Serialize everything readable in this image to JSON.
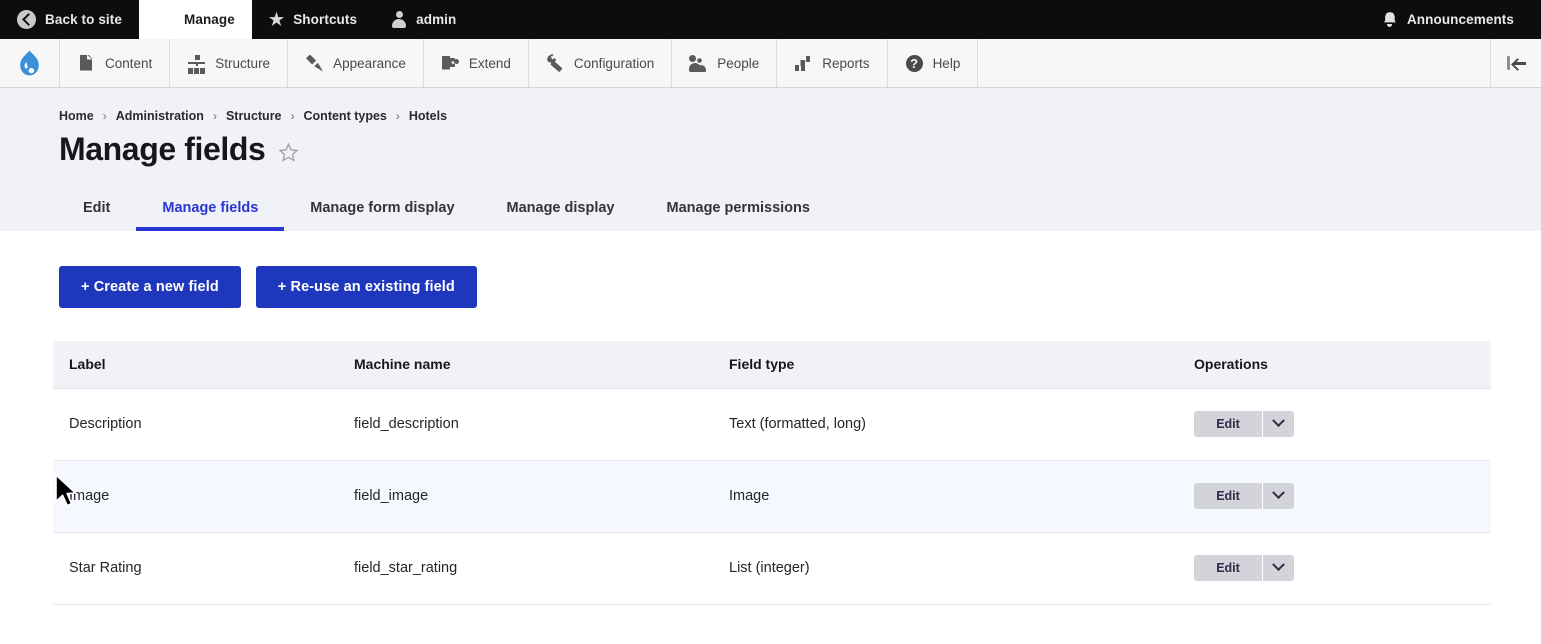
{
  "toolbar": {
    "back_to_site": "Back to site",
    "manage": "Manage",
    "shortcuts": "Shortcuts",
    "user": "admin",
    "announcements": "Announcements",
    "icons": {
      "back": "back-circle-icon",
      "manage": "hamburger-icon",
      "shortcuts": "star-icon",
      "user": "person-icon",
      "announcements": "bell-icon"
    }
  },
  "admin_menu": {
    "logo": "drupal-droplet-logo",
    "items": [
      {
        "label": "Content",
        "icon": "document-icon"
      },
      {
        "label": "Structure",
        "icon": "sitemap-icon"
      },
      {
        "label": "Appearance",
        "icon": "paintbrush-icon"
      },
      {
        "label": "Extend",
        "icon": "puzzle-piece-icon"
      },
      {
        "label": "Configuration",
        "icon": "wrench-icon"
      },
      {
        "label": "People",
        "icon": "people-icon"
      },
      {
        "label": "Reports",
        "icon": "bar-chart-icon"
      },
      {
        "label": "Help",
        "icon": "question-circle-icon"
      }
    ],
    "orientation_toggle": "collapse-sidebar-icon"
  },
  "breadcrumb": [
    "Home",
    "Administration",
    "Structure",
    "Content types",
    "Hotels"
  ],
  "page": {
    "title": "Manage fields",
    "bookmark_icon": "star-outline-icon"
  },
  "tabs": [
    {
      "label": "Edit",
      "active": false
    },
    {
      "label": "Manage fields",
      "active": true
    },
    {
      "label": "Manage form display",
      "active": false
    },
    {
      "label": "Manage display",
      "active": false
    },
    {
      "label": "Manage permissions",
      "active": false
    }
  ],
  "actions": {
    "create_new_field": "+ Create a new field",
    "reuse_existing_field": "+ Re-use an existing field"
  },
  "table": {
    "headers": [
      "Label",
      "Machine name",
      "Field type",
      "Operations"
    ],
    "rows": [
      {
        "label": "Description",
        "machine_name": "field_description",
        "field_type": "Text (formatted, long)",
        "operation": "Edit",
        "hovered": false
      },
      {
        "label": "Image",
        "machine_name": "field_image",
        "field_type": "Image",
        "operation": "Edit",
        "hovered": true
      },
      {
        "label": "Star Rating",
        "machine_name": "field_star_rating",
        "field_type": "List (integer)",
        "operation": "Edit",
        "hovered": false
      }
    ]
  },
  "colors": {
    "toolbar_bg": "#0d0d0d",
    "menu_bg": "#f7f7f7",
    "header_bg": "#f1f2f7",
    "accent_blue": "#2a35d4",
    "button_blue": "#1f37bd",
    "drupal_blue": "#3b8fd9",
    "row_hover": "#f5f8fe",
    "dropbutton_bg": "#d3d4d9"
  }
}
